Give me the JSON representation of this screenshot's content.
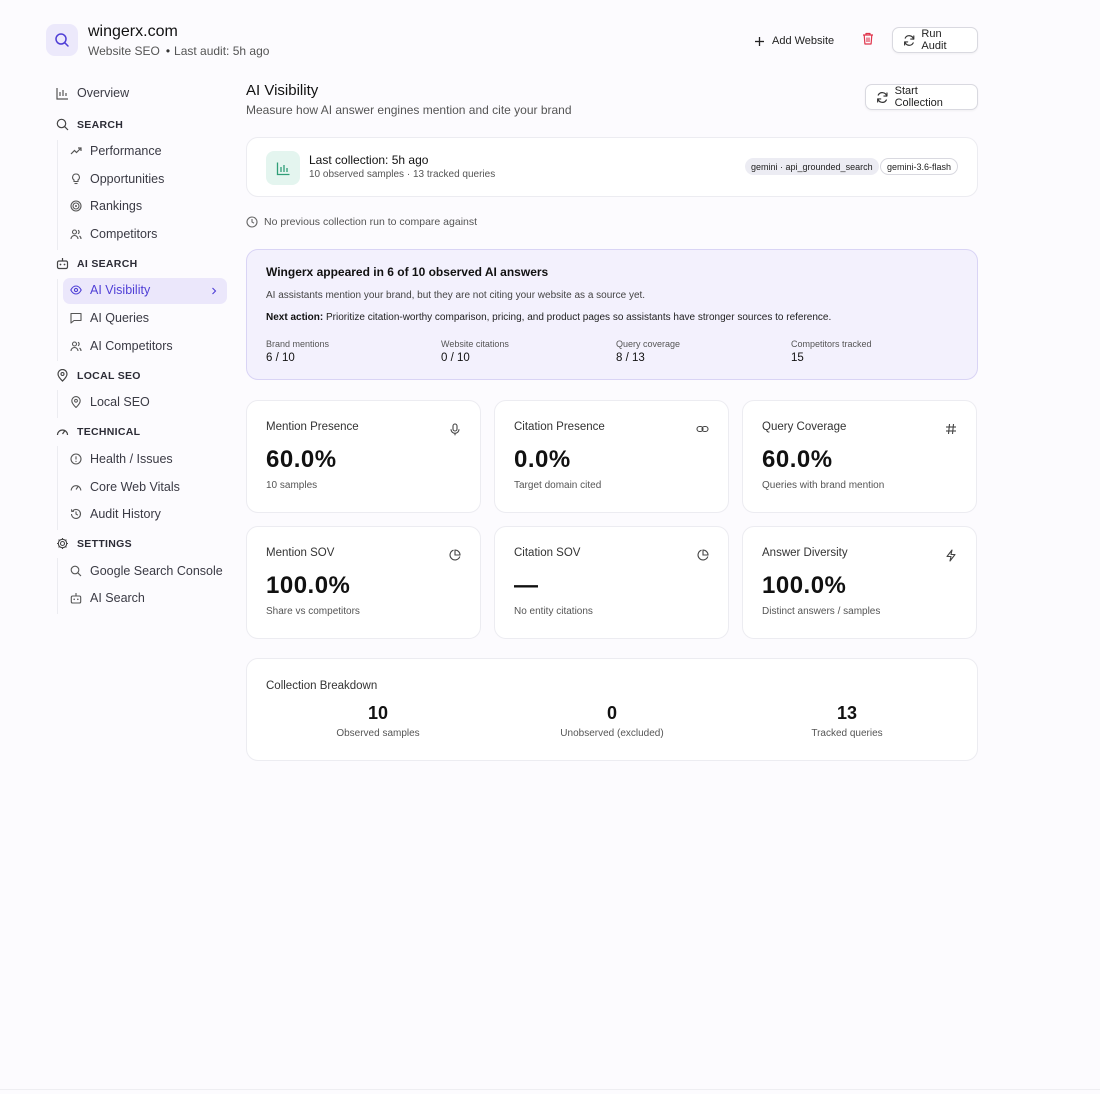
{
  "header": {
    "site_name": "wingerx.com",
    "site_type": "Website SEO",
    "last_audit": "Last audit: 5h ago",
    "add_website": "Add Website",
    "run_audit": "Run Audit"
  },
  "sidebar": {
    "overview": "Overview",
    "sections": {
      "search": "SEARCH",
      "ai_search": "AI SEARCH",
      "local_seo": "LOCAL SEO",
      "technical": "TECHNICAL",
      "settings": "SETTINGS"
    },
    "items": {
      "performance": "Performance",
      "opportunities": "Opportunities",
      "rankings": "Rankings",
      "competitors": "Competitors",
      "ai_visibility": "AI Visibility",
      "ai_queries": "AI Queries",
      "ai_competitors": "AI Competitors",
      "local_seo": "Local SEO",
      "health_issues": "Health / Issues",
      "core_web_vitals": "Core Web Vitals",
      "audit_history": "Audit History",
      "google_search_console": "Google Search Console",
      "ai_search": "AI Search"
    },
    "active": "ai_visibility",
    "accent_color": "#4f3fd6"
  },
  "main": {
    "title": "AI Visibility",
    "subtitle": "Measure how AI answer engines mention and cite your brand",
    "start_collection": "Start Collection",
    "collection": {
      "title": "Last collection: 5h ago",
      "sub": "10 observed samples · 13 tracked queries",
      "tags": [
        "gemini · api_grounded_search",
        "gemini-3.6-flash"
      ]
    },
    "no_previous": "No previous collection run to compare against",
    "insight": {
      "title": "Wingerx appeared in 6 of 10 observed AI answers",
      "text": "AI assistants mention your brand, but they are not citing your website as a source yet.",
      "next_label": "Next action:",
      "next_text": "Prioritize citation-worthy comparison, pricing, and product pages so assistants have stronger sources to reference.",
      "stats": [
        {
          "label": "Brand mentions",
          "value": "6 / 10"
        },
        {
          "label": "Website citations",
          "value": "0 / 10"
        },
        {
          "label": "Query coverage",
          "value": "8 / 13"
        },
        {
          "label": "Competitors tracked",
          "value": "15"
        }
      ]
    },
    "metrics": [
      {
        "label": "Mention Presence",
        "value": "60.0%",
        "sub": "10 samples",
        "icon": "microphone-icon"
      },
      {
        "label": "Citation Presence",
        "value": "0.0%",
        "sub": "Target domain cited",
        "icon": "link-icon"
      },
      {
        "label": "Query Coverage",
        "value": "60.0%",
        "sub": "Queries with brand mention",
        "icon": "hash-icon"
      },
      {
        "label": "Mention SOV",
        "value": "100.0%",
        "sub": "Share vs competitors",
        "icon": "pie-chart-icon"
      },
      {
        "label": "Citation SOV",
        "value": "—",
        "sub": "No entity citations",
        "icon": "pie-chart-icon"
      },
      {
        "label": "Answer Diversity",
        "value": "100.0%",
        "sub": "Distinct answers / samples",
        "icon": "lightning-icon"
      }
    ],
    "breakdown": {
      "title": "Collection Breakdown",
      "items": [
        {
          "value": "10",
          "label": "Observed samples"
        },
        {
          "value": "0",
          "label": "Unobserved (excluded)"
        },
        {
          "value": "13",
          "label": "Tracked queries"
        }
      ]
    }
  }
}
